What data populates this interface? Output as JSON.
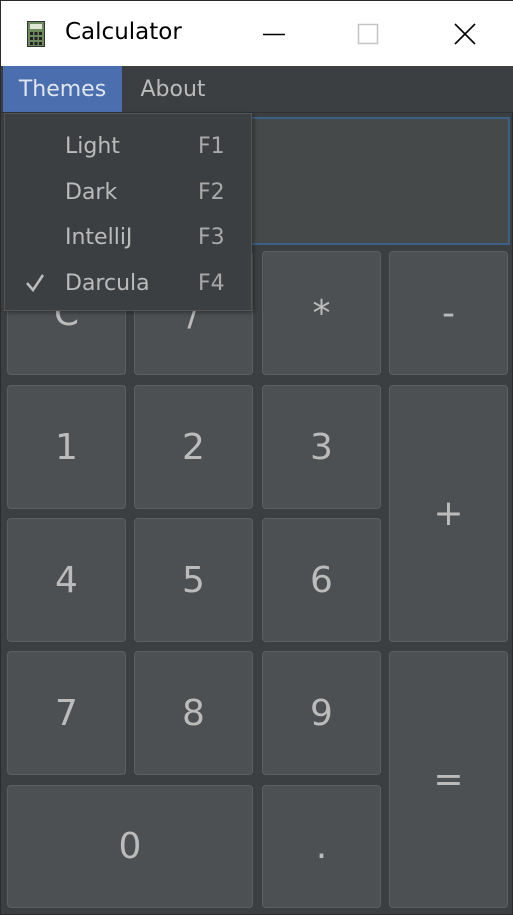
{
  "window": {
    "title": "Calculator",
    "app_icon": "calculator-icon",
    "controls": [
      "minimize-icon",
      "maximize-icon",
      "close-icon"
    ]
  },
  "menubar": {
    "items": [
      {
        "label": "Themes",
        "active": true
      },
      {
        "label": "About",
        "active": false
      }
    ]
  },
  "themes_menu": {
    "items": [
      {
        "label": "Light",
        "shortcut": "F1",
        "checked": false
      },
      {
        "label": "Dark",
        "shortcut": "F2",
        "checked": false
      },
      {
        "label": "IntelliJ",
        "shortcut": "F3",
        "checked": false
      },
      {
        "label": "Darcula",
        "shortcut": "F4",
        "checked": true
      }
    ],
    "check_glyph": "✔"
  },
  "display": {
    "value": ""
  },
  "keypad": {
    "clear": "C",
    "divide": "/",
    "multiply": "*",
    "subtract": "-",
    "add": "+",
    "equals": "=",
    "one": "1",
    "two": "2",
    "three": "3",
    "four": "4",
    "five": "5",
    "six": "6",
    "seven": "7",
    "eight": "8",
    "nine": "9",
    "zero": "0",
    "decimal": "."
  },
  "colors": {
    "background": "#3c3f41",
    "button": "#4c5052",
    "text": "#bbbbbb",
    "menu_selected": "#4b6eaf",
    "display_border": "#3d6185"
  }
}
